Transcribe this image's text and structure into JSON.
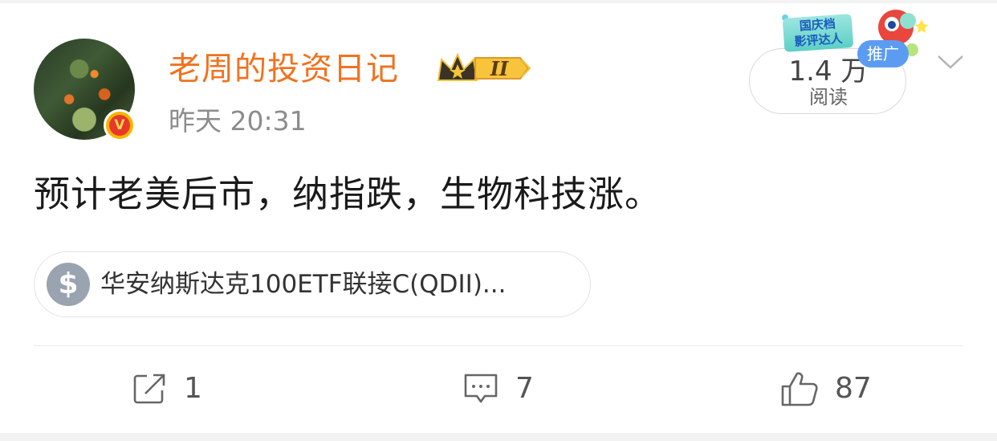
{
  "post": {
    "username": "老周的投资日记",
    "member_level": "II",
    "verified_badge": "V",
    "timestamp": "昨天 20:31",
    "text": "预计老美后市，纳指跌，生物科技涨。",
    "read_count": "1.4 万",
    "read_label": "阅读",
    "promo_label_line1": "国庆档",
    "promo_label_line2": "影评达人",
    "push_label": "推广",
    "fund_card": {
      "icon_glyph": "$",
      "name": "华安纳斯达克100ETF联接C(QDII)..."
    }
  },
  "actions": {
    "repost_count": "1",
    "comment_count": "7",
    "like_count": "87"
  },
  "icons": {
    "crown": "crown-icon",
    "chevron": "chevron-down-icon",
    "repost": "repost-icon",
    "comment": "comment-icon",
    "like": "thumbs-up-icon",
    "fund": "dollar-icon"
  },
  "colors": {
    "username": "#f0721f",
    "push_badge": "#5b9cf2",
    "fund_icon_bg": "#9aa3b0",
    "verified_bg": "#f7b500"
  }
}
